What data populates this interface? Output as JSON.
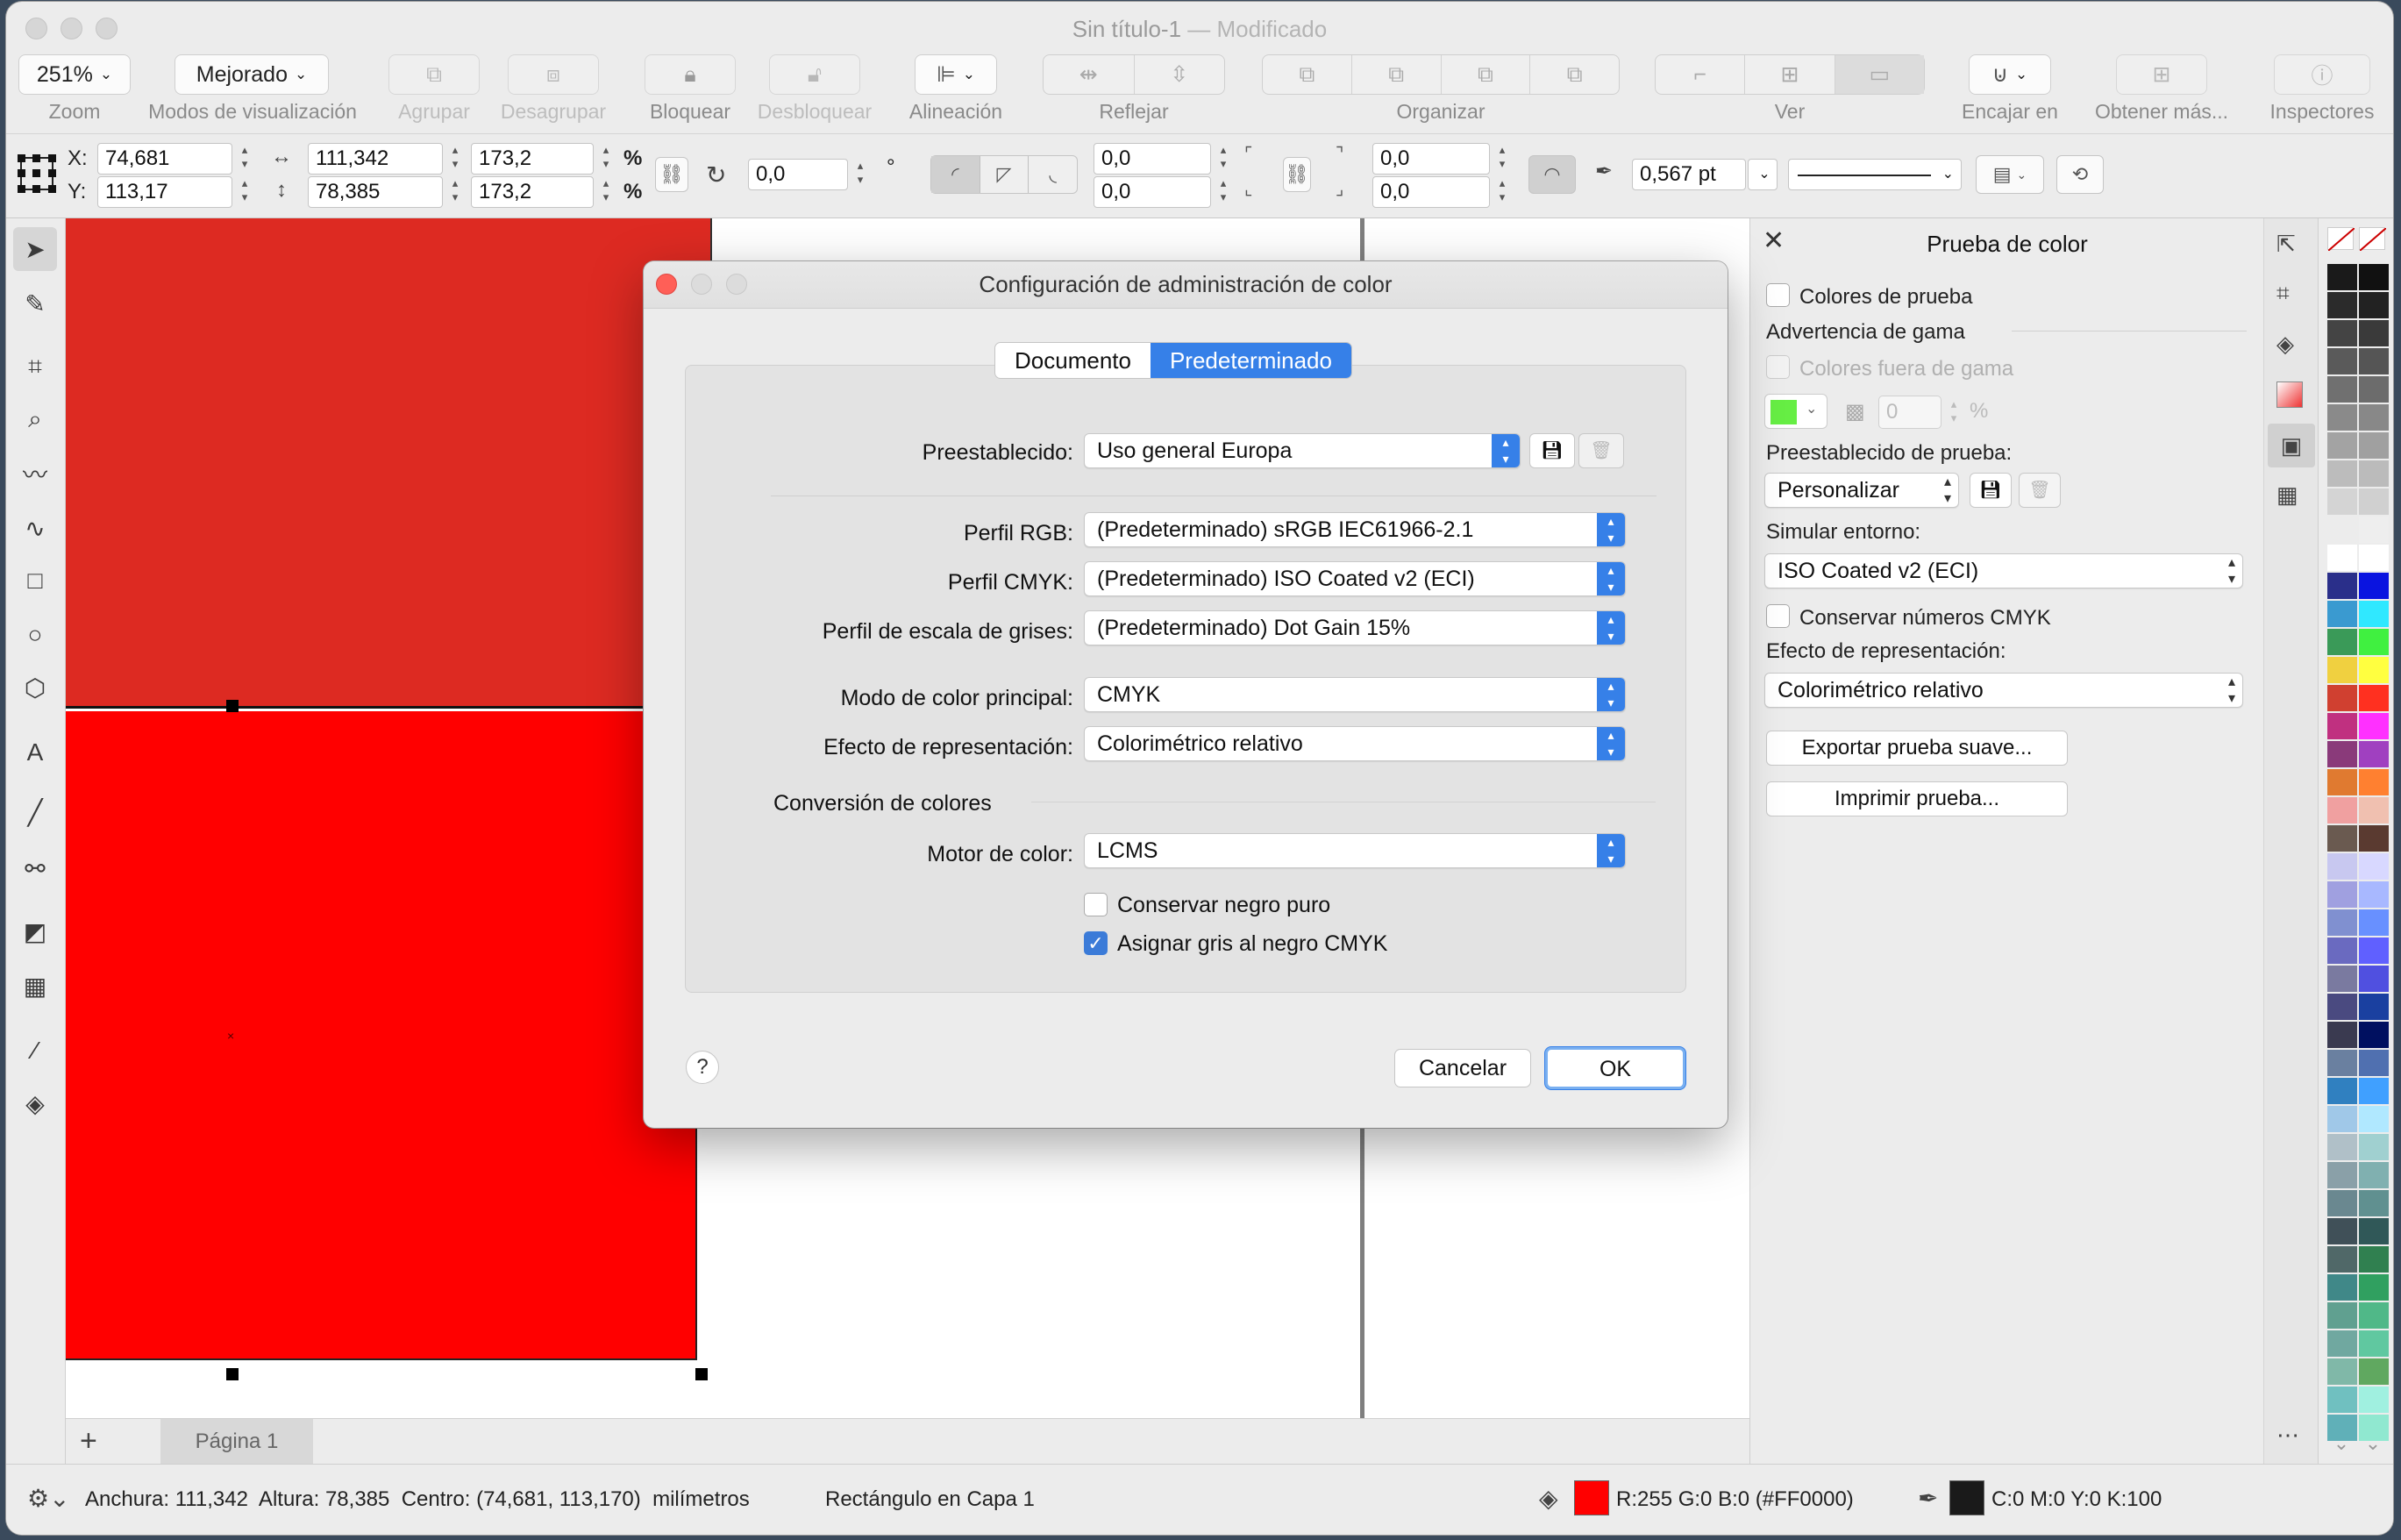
{
  "window": {
    "title": "Sin título-1",
    "title_suffix": " — Modificado"
  },
  "toolbar": {
    "zoom": {
      "value": "251%",
      "label": "Zoom"
    },
    "view_modes": {
      "value": "Mejorado",
      "label": "Modos de visualización"
    },
    "group": "Agrupar",
    "ungroup": "Desagrupar",
    "lock": "Bloquear",
    "unlock": "Desbloquear",
    "align": "Alineación",
    "mirror": "Reflejar",
    "arrange": "Organizar",
    "view": "Ver",
    "snap": "Encajar en",
    "get_more": "Obtener más...",
    "inspectors": "Inspectores"
  },
  "propbar": {
    "x_label": "X:",
    "x": "74,681",
    "y_label": "Y:",
    "y": "113,17",
    "width": "111,342",
    "height": "78,385",
    "scale_w": "173,2",
    "scale_h": "173,2",
    "pct": "%",
    "rotation": "0,0",
    "degree": "°",
    "c1": "0,0",
    "c2": "0,0",
    "c3": "0,0",
    "c4": "0,0",
    "stroke_width": "0,567 pt"
  },
  "pagebar": {
    "add": "+",
    "page_tab": "Página 1"
  },
  "status": {
    "dims": "Anchura: 111,342  Altura: 78,385  Centro: (74,681, 113,170)  milímetros",
    "selection": "Rectángulo en Capa 1",
    "fill_color": "#FF0000",
    "fill_text": "R:255 G:0 B:0 (#FF0000)",
    "stroke_color": "#1a1a1a",
    "stroke_text": "C:0 M:0 Y:0 K:100"
  },
  "proof_panel": {
    "title": "Prueba de color",
    "proof_colors": "Colores de prueba",
    "gamut_warning": "Advertencia de gama",
    "out_of_gamut": "Colores fuera de gama",
    "gamut_color": "#66ee44",
    "opacity": "0",
    "pct": "%",
    "proof_preset_label": "Preestablecido de prueba:",
    "proof_preset": "Personalizar",
    "simulate_label": "Simular entorno:",
    "simulate": "ISO Coated v2 (ECI)",
    "preserve_cmyk": "Conservar números CMYK",
    "rendering_label": "Efecto de representación:",
    "rendering": "Colorimétrico relativo",
    "export_soft": "Exportar prueba suave...",
    "print_proof": "Imprimir prueba..."
  },
  "dialog": {
    "title": "Configuración de administración de color",
    "tabs": [
      "Documento",
      "Predeterminado"
    ],
    "active_tab": 1,
    "preset_label": "Preestablecido:",
    "preset": "Uso general Europa",
    "rgb_label": "Perfil RGB:",
    "rgb": "(Predeterminado) sRGB IEC61966-2.1",
    "cmyk_label": "Perfil CMYK:",
    "cmyk": "(Predeterminado) ISO Coated v2 (ECI)",
    "gray_label": "Perfil de escala de grises:",
    "gray": "(Predeterminado) Dot Gain 15%",
    "mode_label": "Modo de color principal:",
    "mode": "CMYK",
    "intent_label": "Efecto de representación:",
    "intent": "Colorimétrico relativo",
    "conversion_label": "Conversión de colores",
    "engine_label": "Motor de color:",
    "engine": "LCMS",
    "keep_black": "Conservar negro puro",
    "keep_black_checked": false,
    "gray_black": "Asignar gris al negro CMYK",
    "gray_black_checked": true,
    "help": "?",
    "cancel": "Cancelar",
    "ok": "OK"
  },
  "colors": {
    "accent": "#3680e8",
    "red_top": "#dd2a22",
    "red_bottom": "#ff0000"
  }
}
